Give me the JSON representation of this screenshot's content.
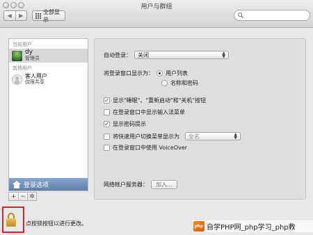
{
  "window": {
    "title": "用户与群组"
  },
  "toolbar": {
    "back_glyph": "◀",
    "forward_glyph": "▶",
    "show_all_label": "全部显示",
    "search_icon": "search-icon",
    "search_placeholder": ""
  },
  "users": {
    "current_label": "当前用户",
    "current": {
      "name": "dy",
      "role": "管理员"
    },
    "other_label": "其他用户",
    "others": [
      {
        "name": "客人用户",
        "role": "仅限共享"
      }
    ],
    "login_options_label": "登录选项",
    "add_glyph": "+",
    "remove_glyph": "−",
    "action_glyph": "✲"
  },
  "login": {
    "auto_login_label": "自动登录：",
    "auto_login_value": "关闭",
    "display_as_label": "将登录窗口显示为：",
    "display_options": [
      {
        "label": "用户列表",
        "selected": true
      },
      {
        "label": "名称和密码",
        "selected": false
      }
    ],
    "checkboxes": [
      {
        "label": "显示\"睡眠\"、\"重新启动\"和\"关机\"按钮",
        "checked": true,
        "enabled": true
      },
      {
        "label": "在登录窗口中显示输入法菜单",
        "checked": false,
        "enabled": true
      },
      {
        "label": "显示密码提示",
        "checked": true,
        "enabled": true
      },
      {
        "label": "将快速用户切换菜单显示为",
        "checked": false,
        "enabled": true
      },
      {
        "label": "在登录窗口中使用 VoiceOver",
        "checked": false,
        "enabled": true
      }
    ],
    "fast_switch_value": "全名",
    "network_server_label": "网络帐户服务器：",
    "join_button_label": "加入..."
  },
  "lock": {
    "text": "点按锁按钮以进行更改。",
    "icon": "lock-icon"
  },
  "watermark": {
    "text": "自学PHP网_php学习_php教",
    "logo_text": "php"
  },
  "colors": {
    "accent": "#6a8ab5",
    "highlight_box": "#d8222a"
  }
}
